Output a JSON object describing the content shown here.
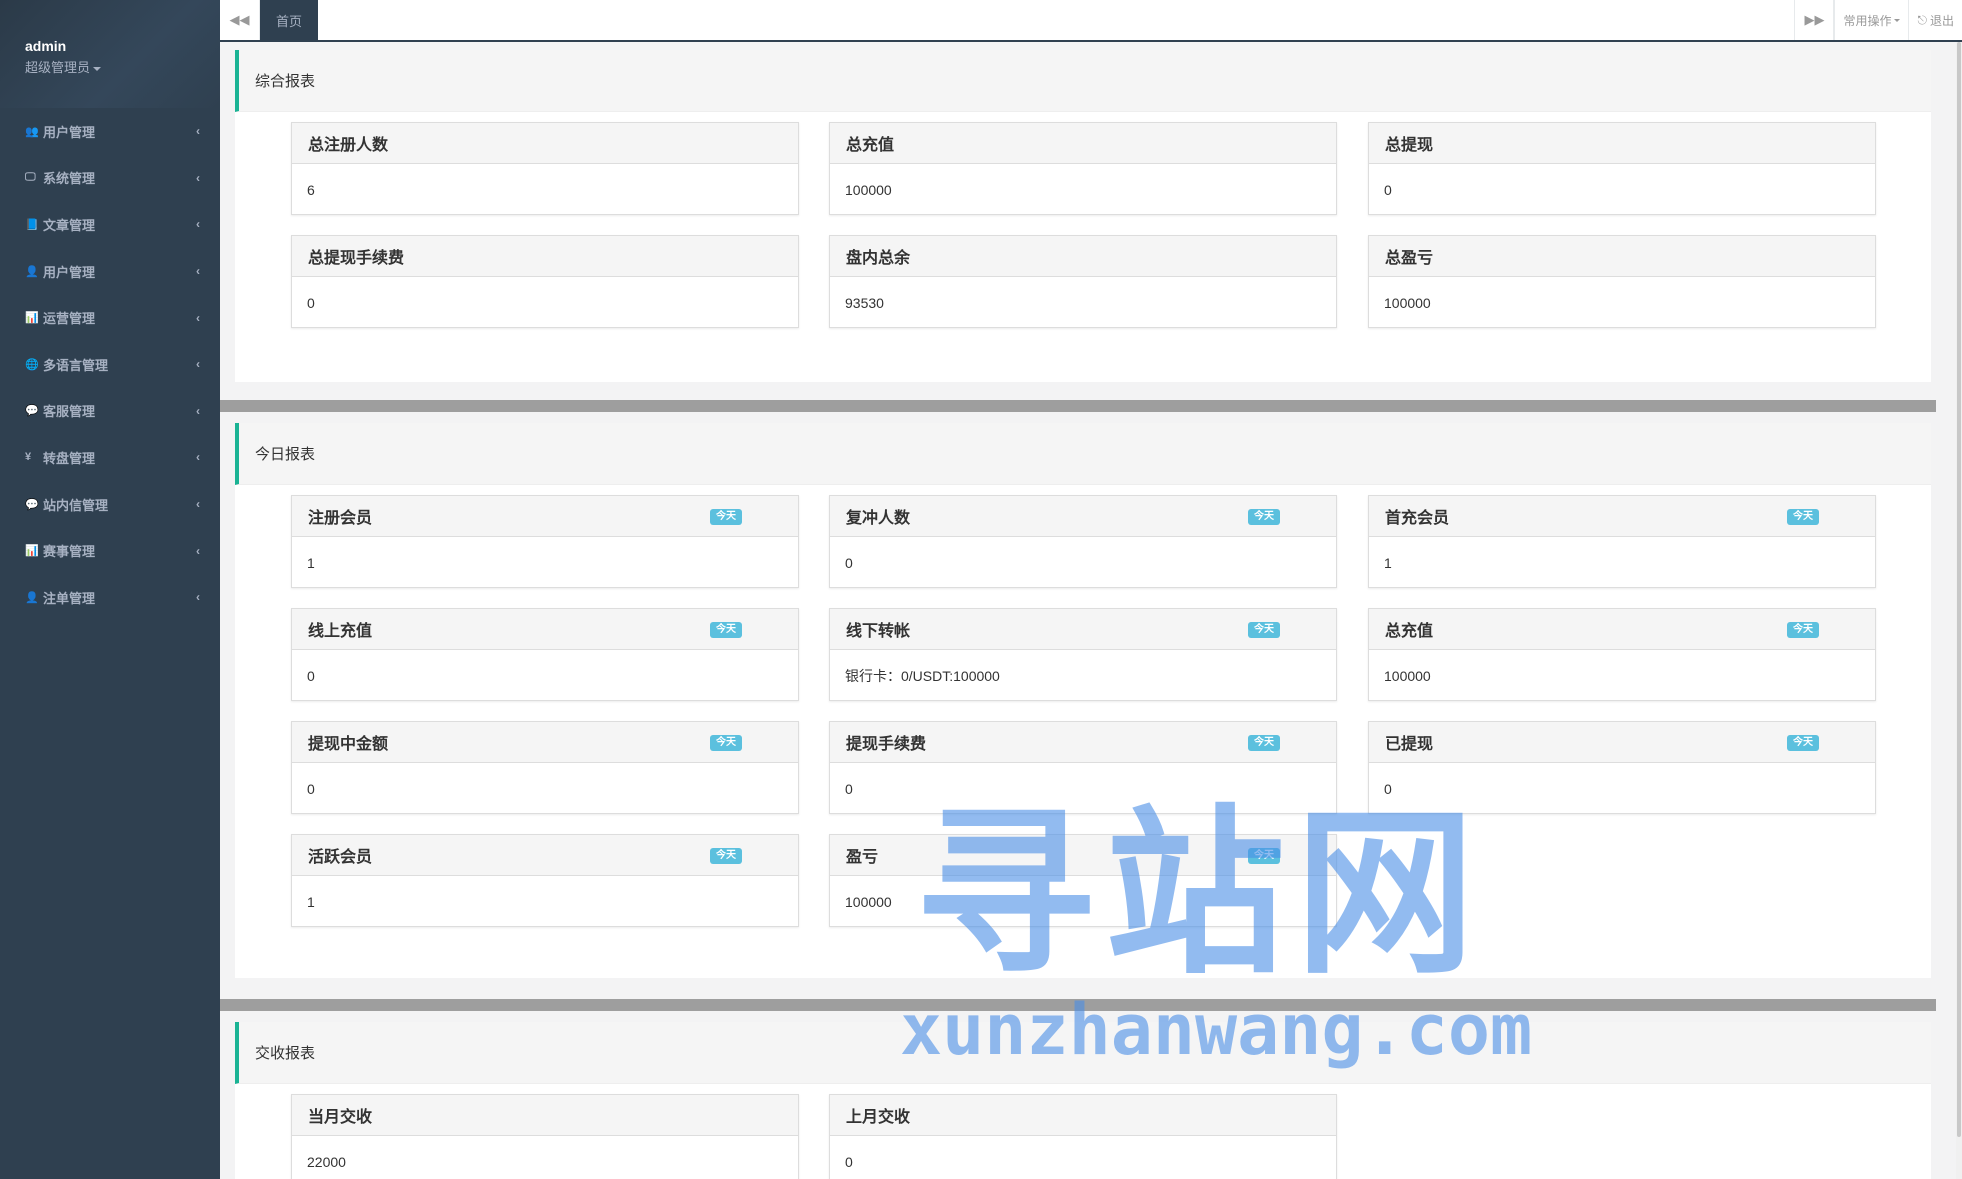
{
  "sidebar": {
    "user": {
      "name": "admin",
      "role": "超级管理员"
    },
    "items": [
      {
        "icon": "users-icon",
        "glyph": "👥",
        "label": "用户管理"
      },
      {
        "icon": "desktop-icon",
        "glyph": "🖵",
        "label": "系统管理"
      },
      {
        "icon": "book-icon",
        "glyph": "📘",
        "label": "文章管理"
      },
      {
        "icon": "user-icon",
        "glyph": "👤",
        "label": "用户管理"
      },
      {
        "icon": "bar-chart-icon",
        "glyph": "📊",
        "label": "运营管理"
      },
      {
        "icon": "globe-icon",
        "glyph": "🌐",
        "label": "多语言管理"
      },
      {
        "icon": "comment-icon",
        "glyph": "💬",
        "label": "客服管理"
      },
      {
        "icon": "yen-icon",
        "glyph": "¥",
        "label": "转盘管理"
      },
      {
        "icon": "comment-icon",
        "glyph": "💬",
        "label": "站内信管理"
      },
      {
        "icon": "bar-chart-icon",
        "glyph": "📊",
        "label": "赛事管理"
      },
      {
        "icon": "user-icon",
        "glyph": "👤",
        "label": "注单管理"
      }
    ]
  },
  "topbar": {
    "home_tab": "首页",
    "common_ops": "常用操作",
    "logout": "退出"
  },
  "sections": {
    "summary": {
      "title": "综合报表",
      "cards": [
        {
          "label": "总注册人数",
          "value": "6"
        },
        {
          "label": "总充值",
          "value": "100000"
        },
        {
          "label": "总提现",
          "value": "0"
        },
        {
          "label": "总提现手续费",
          "value": "0"
        },
        {
          "label": "盘内总余",
          "value": "93530"
        },
        {
          "label": "总盈亏",
          "value": "100000"
        }
      ]
    },
    "today": {
      "title": "今日报表",
      "badge": "今天",
      "cards": [
        {
          "label": "注册会员",
          "value": "1"
        },
        {
          "label": "复冲人数",
          "value": "0"
        },
        {
          "label": "首充会员",
          "value": "1"
        },
        {
          "label": "线上充值",
          "value": "0"
        },
        {
          "label": "线下转帐",
          "value": "银行卡：0/USDT:100000"
        },
        {
          "label": "总充值",
          "value": "100000"
        },
        {
          "label": "提现中金额",
          "value": "0"
        },
        {
          "label": "提现手续费",
          "value": "0"
        },
        {
          "label": "已提现",
          "value": "0"
        },
        {
          "label": "活跃会员",
          "value": "1"
        },
        {
          "label": "盈亏",
          "value": "100000"
        }
      ]
    },
    "settlement": {
      "title": "交收报表",
      "cards": [
        {
          "label": "当月交收",
          "value": "22000"
        },
        {
          "label": "上月交收",
          "value": "0"
        }
      ]
    }
  },
  "watermark": {
    "cn": "寻站网",
    "en": "xunzhanwang.com"
  }
}
